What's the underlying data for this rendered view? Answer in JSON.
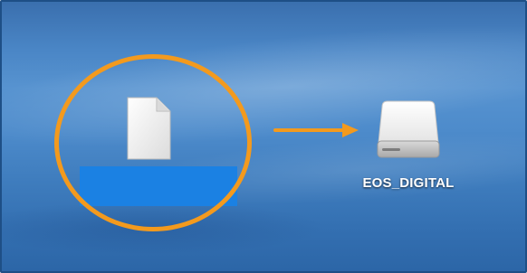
{
  "desktop": {
    "file_item": {
      "icon": "document-icon",
      "name": ""
    },
    "drive_item": {
      "icon": "external-drive-icon",
      "label": "EOS_DIGITAL"
    },
    "annotation": {
      "ring_color": "#f39a1e",
      "arrow_color": "#f39a1e",
      "selection_color": "#1b81e3"
    }
  }
}
